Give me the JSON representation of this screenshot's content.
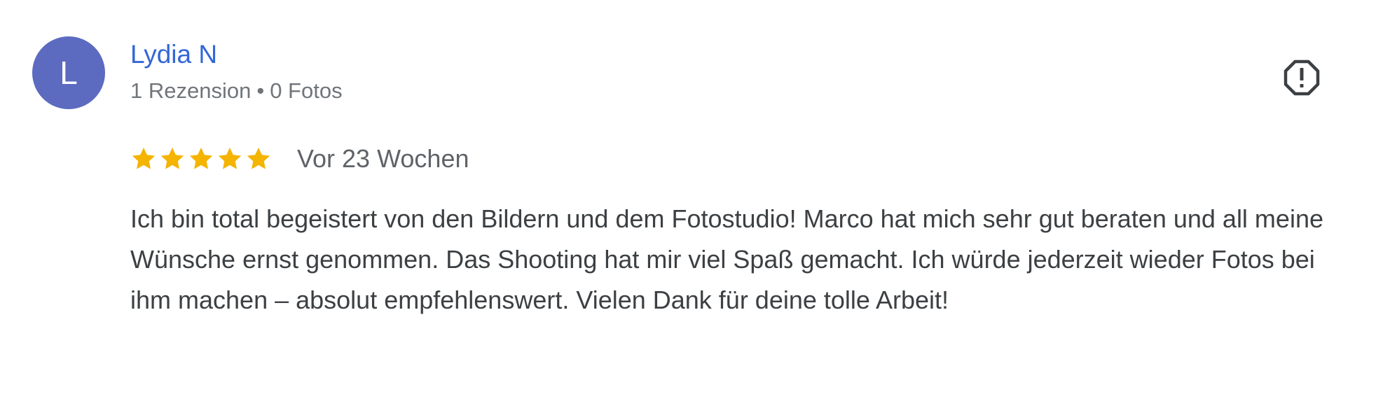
{
  "review": {
    "author": {
      "initial": "L",
      "name": "Lydia N",
      "reviews_count": "1 Rezension",
      "separator": "•",
      "photos_count": "0 Fotos",
      "avatar_color": "#5c6bc0",
      "name_color": "#3367d6"
    },
    "rating": {
      "stars": 5,
      "max": 5,
      "star_color": "#f4b400",
      "star_icon": "star-icon"
    },
    "date": "Vor 23 Wochen",
    "text": "Ich bin total begeistert von den Bildern und dem Fotostudio! Marco hat mich sehr gut beraten und all meine Wünsche ernst genommen. Das Shooting hat mir viel Spaß gemacht. Ich würde jederzeit wieder Fotos bei ihm machen – absolut empfehlenswert. Vielen Dank für deine tolle Arbeit!",
    "report_icon": "report-icon"
  }
}
